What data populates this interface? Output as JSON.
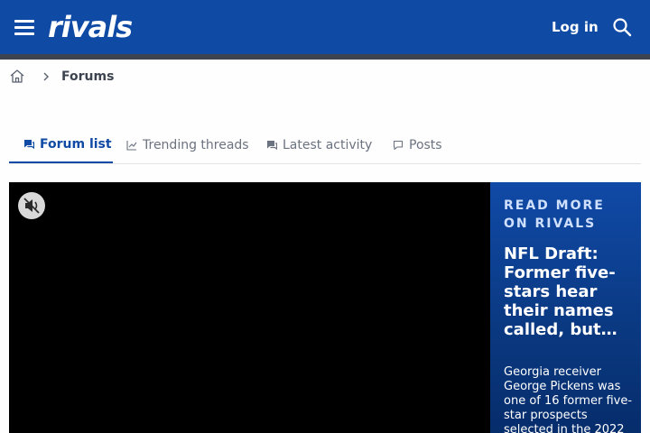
{
  "header": {
    "logo_text": "rivals",
    "login_label": "Log in",
    "menu_icon": "hamburger-icon",
    "search_icon": "search-icon"
  },
  "breadcrumb": {
    "home_icon": "home-icon",
    "items": [
      "Forums"
    ]
  },
  "tabs": [
    {
      "label": "Forum list",
      "icon": "comments-icon",
      "active": true
    },
    {
      "label": "Trending threads",
      "icon": "chart-line-icon",
      "active": false
    },
    {
      "label": "Latest activity",
      "icon": "comments-outline-icon",
      "active": false
    },
    {
      "label": "Posts",
      "icon": "comment-icon",
      "active": false
    }
  ],
  "video": {
    "mute_icon": "volume-muted-icon"
  },
  "promo": {
    "kicker": "READ MORE ON RIVALS",
    "title": "NFL Draft: Former five-stars hear their names called, but…",
    "body": "Georgia receiver George Pickens was one of 16 former five-star prospects selected in the 2022"
  },
  "colors": {
    "brand": "#0f4aa5",
    "strip": "#3d4450",
    "tab_active": "#0f4aa5",
    "tab_inactive": "#6b7280"
  }
}
